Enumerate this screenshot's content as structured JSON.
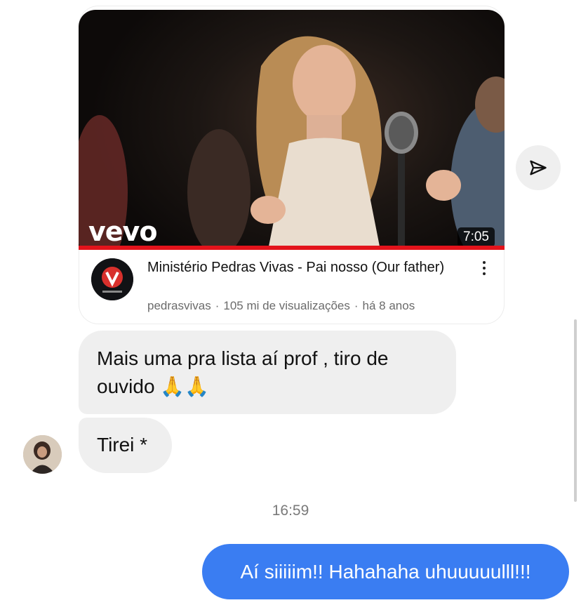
{
  "video": {
    "logo": "vevo",
    "duration": "7:05",
    "progress_fraction": 1.0,
    "title": "Ministério Pedras Vivas - Pai nosso (Our father)",
    "channel": "pedrasvivas",
    "views": "105 mi de visualizações",
    "age": "há 8 anos",
    "separator": "·",
    "channel_avatar_icon": "pedras-vivas-logo",
    "menu_icon": "more-vertical-icon"
  },
  "share": {
    "icon": "send-icon"
  },
  "messages": {
    "incoming_1": {
      "text": "Mais uma pra lista aí prof , tiro de ouvido",
      "emoji": "🙏🙏"
    },
    "incoming_2": {
      "text": "Tirei *"
    },
    "timestamp": "16:59",
    "outgoing_1": {
      "text": "Aí siiiiim!! Hahahaha uhuuuuulll!!!"
    }
  },
  "colors": {
    "incoming_bubble": "#efefef",
    "outgoing_bubble": "#3a7df2",
    "progress": "#e3131b"
  }
}
